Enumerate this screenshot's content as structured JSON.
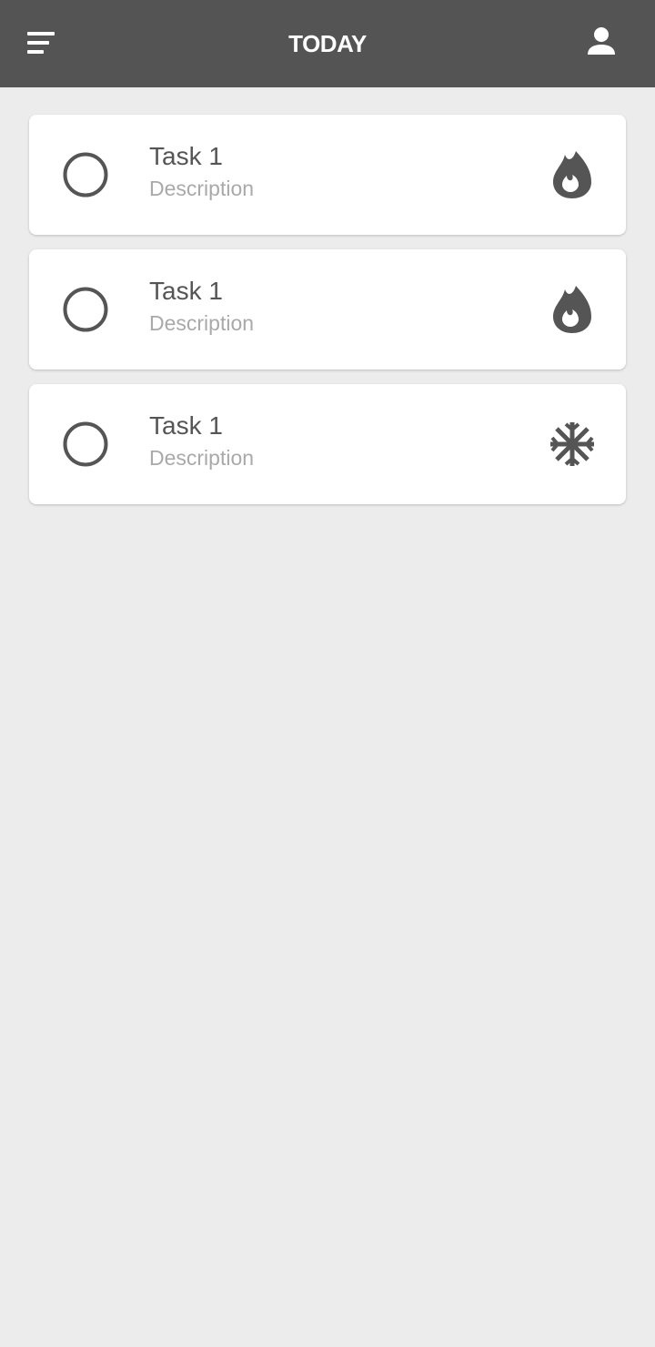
{
  "header": {
    "title": "TODAY",
    "menu_icon": "menu-icon",
    "profile_icon": "person-icon"
  },
  "tasks": [
    {
      "title": "Task 1",
      "description": "Description",
      "priority_icon": "fire-icon",
      "completed": false
    },
    {
      "title": "Task 1",
      "description": "Description",
      "priority_icon": "fire-icon",
      "completed": false
    },
    {
      "title": "Task 1",
      "description": "Description",
      "priority_icon": "snowflake-icon",
      "completed": false
    }
  ],
  "colors": {
    "app_bar": "#545454",
    "background": "#ececec",
    "card": "#ffffff",
    "icon": "#555555",
    "title_text": "#555555",
    "description_text": "#a9a9a9"
  }
}
